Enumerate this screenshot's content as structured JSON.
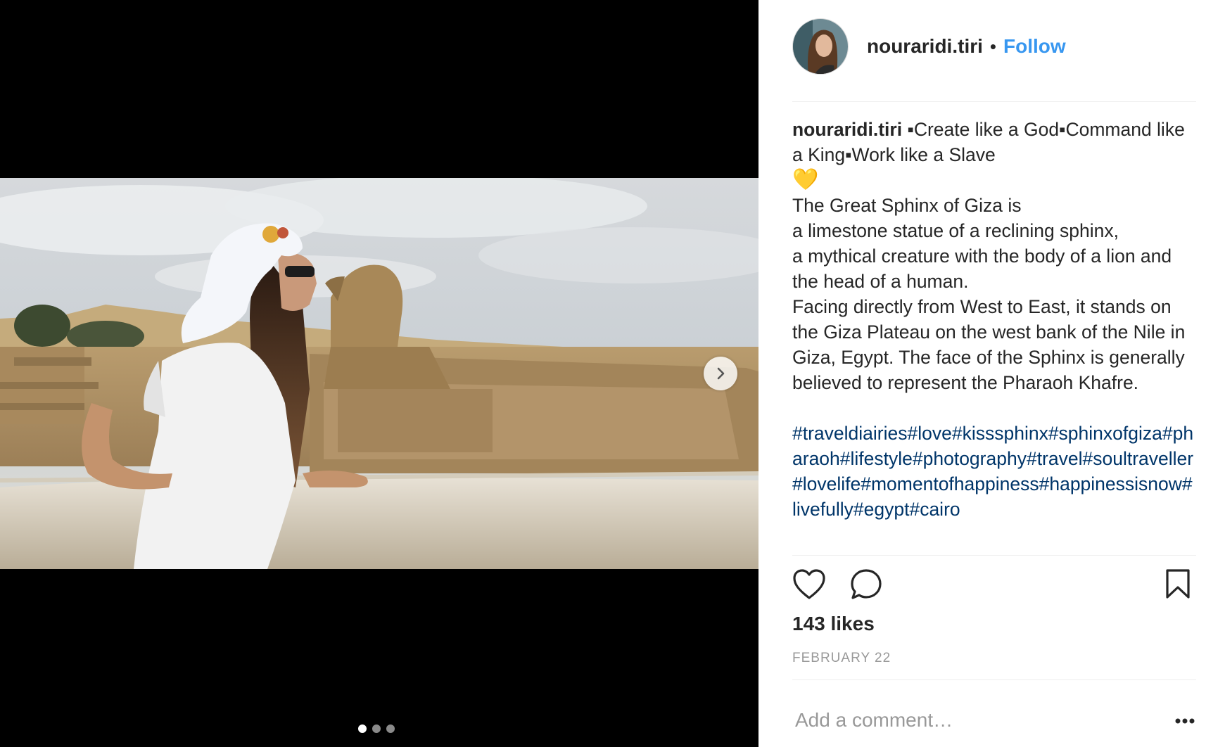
{
  "post": {
    "username": "nouraridi.tiri",
    "separator": "•",
    "follow_label": "Follow",
    "caption": {
      "username": "nouraridi.tiri",
      "text": " ▪Create like a God▪Command like a King▪Work like a Slave",
      "emoji": "💛",
      "body": "The Great Sphinx of Giza is\na limestone statue of a reclining sphinx,\na mythical creature with the body of a lion and the head of a human.\nFacing directly from West to East, it stands on the Giza Plateau on the west bank of the Nile in Giza, Egypt. The face of the Sphinx is generally believed to represent the Pharaoh Khafre.",
      "hashtags": "#traveldiairies#love#kisssphinx#sphinxofgiza#pharaoh#lifestyle#photography#travel#soultraveller#lovelife#momentofhappiness#happinessisnow#livefully#egypt#cairo"
    },
    "likes_label": "143 likes",
    "date_label": "FEBRUARY 22",
    "comment_placeholder": "Add a comment…"
  },
  "carousel": {
    "slide_count": 3,
    "active_index": 0
  },
  "icons": {
    "like": "heart-outline-icon",
    "comment": "speech-bubble-icon",
    "save": "bookmark-icon",
    "more": "more-dots-icon",
    "next": "chevron-right-icon"
  },
  "colors": {
    "accent": "#3897f0",
    "hashtag": "#003569",
    "muted": "#999999"
  }
}
